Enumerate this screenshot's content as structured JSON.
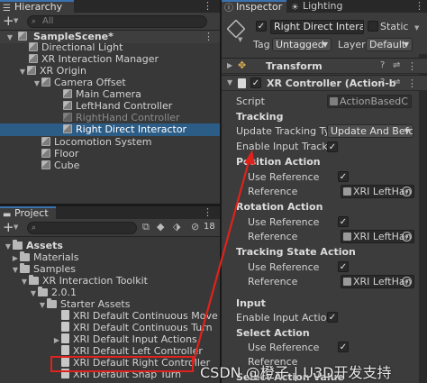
{
  "hierarchy": {
    "tab_label": "Hierarchy",
    "add_label": "+",
    "search_placeholder": "All",
    "rows": [
      {
        "label": "SampleScene*",
        "bold": true
      },
      {
        "label": "Directional Light"
      },
      {
        "label": "XR Interaction Manager"
      },
      {
        "label": "XR Origin"
      },
      {
        "label": "Camera Offset"
      },
      {
        "label": "Main Camera"
      },
      {
        "label": "LeftHand Controller"
      },
      {
        "label": "RightHand Controller",
        "dim": true
      },
      {
        "label": "Right Direct Interactor",
        "selected": true
      },
      {
        "label": "Locomotion System"
      },
      {
        "label": "Floor"
      },
      {
        "label": "Cube"
      }
    ]
  },
  "project": {
    "tab_label": "Project",
    "add_label": "+",
    "hidden_count": "18",
    "rows": [
      {
        "label": "Assets"
      },
      {
        "label": "Materials"
      },
      {
        "label": "Samples"
      },
      {
        "label": "XR Interaction Toolkit"
      },
      {
        "label": "2.0.1"
      },
      {
        "label": "Starter Assets"
      },
      {
        "label": "XRI Default Continuous Move"
      },
      {
        "label": "XRI Default Continuous Turn"
      },
      {
        "label": "XRI Default Input Actions"
      },
      {
        "label": "XRI Default Left Controller"
      },
      {
        "label": "XRI Default Right Controller",
        "boxed": true
      },
      {
        "label": "XRI Default Snap Turn"
      }
    ]
  },
  "inspector": {
    "tab_label": "Inspector",
    "lighting_tab_label": "Lighting",
    "object_name": "Right Direct Interact",
    "static_label": "Static",
    "tag_label": "Tag",
    "tag_value": "Untagged",
    "layer_label": "Layer",
    "layer_value": "Default",
    "transform_label": "Transform",
    "component_label": "XR Controller (Action-b",
    "script_label": "Script",
    "script_value": "ActionBasedC",
    "tracking_header": "Tracking",
    "update_tracking_label": "Update Tracking Typ",
    "update_tracking_value": "Update And Befor",
    "enable_input_tracking_label": "Enable Input Trackin",
    "position_action_header": "Position Action",
    "use_reference_label": "Use Reference",
    "reference_label": "Reference",
    "reference_value": "XRI LeftHan",
    "rotation_action_header": "Rotation Action",
    "tracking_state_header": "Tracking State Action",
    "input_header": "Input",
    "enable_input_actions_label": "Enable Input Actions",
    "select_action_header": "Select Action",
    "select_action_value_header": "Select Action Value"
  },
  "watermark": "CSDN @橙子 | U3D开发支持",
  "colors": {
    "selection": "#2c5d87",
    "tab_accent": "#3a72b0",
    "annotation_red": "#e0221c"
  }
}
